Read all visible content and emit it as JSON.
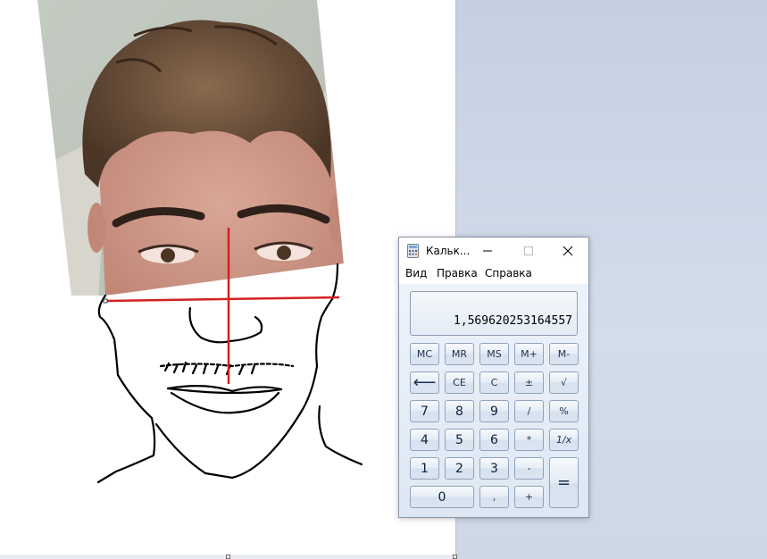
{
  "calculator": {
    "title": "Кальк...",
    "menu": [
      "Вид",
      "Правка",
      "Справка"
    ],
    "display": "1,569620253164557",
    "memory_row": [
      "MC",
      "MR",
      "MS",
      "M+",
      "M-"
    ],
    "row2": [
      "⟵",
      "CE",
      "C",
      "±",
      "√"
    ],
    "row3": [
      "7",
      "8",
      "9",
      "/",
      "%"
    ],
    "row4": [
      "4",
      "5",
      "6",
      "*",
      "1/x"
    ],
    "row5": [
      "1",
      "2",
      "3",
      "-",
      "="
    ],
    "row6": [
      "0",
      ",",
      "+"
    ]
  },
  "colors": {
    "guide_lines": "#d62020",
    "sketch": "#000000",
    "canvas": "#ffffff",
    "desktop": "#c9d5e5"
  },
  "icons": {
    "calculator_app": "calculator-icon",
    "minimize": "minimize-icon",
    "maximize": "maximize-icon",
    "close": "close-icon",
    "backspace": "backspace-icon"
  }
}
